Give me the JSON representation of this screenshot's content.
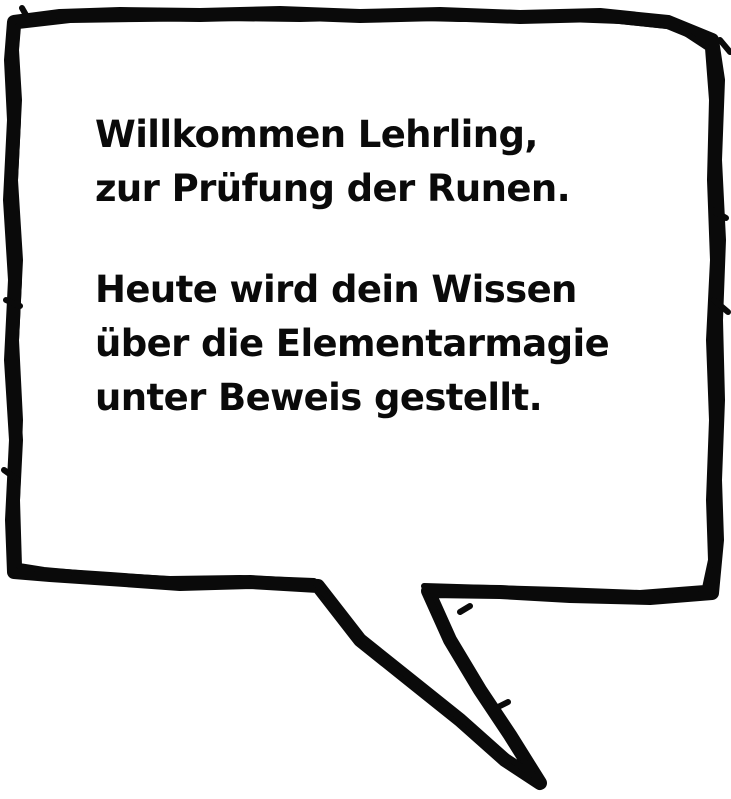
{
  "speech_bubble": {
    "greeting": {
      "line1": "Willkommen Lehrling,",
      "line2": "zur Prüfung der Runen."
    },
    "message": {
      "line1": "Heute wird dein Wissen",
      "line2": "über die Elementarmagie",
      "line3": "unter Beweis gestellt."
    }
  },
  "colors": {
    "background": "#ffffff",
    "outline": "#0a0a0a",
    "text": "#0a0a0a"
  }
}
